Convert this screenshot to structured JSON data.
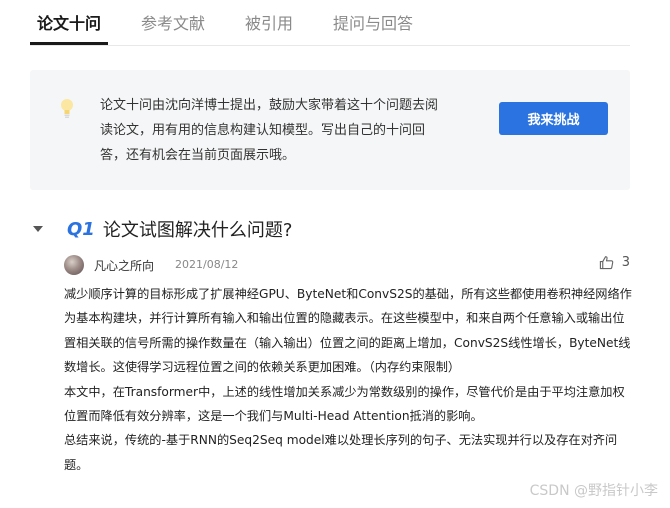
{
  "tabs": [
    {
      "label": "论文十问",
      "active": true
    },
    {
      "label": "参考文献",
      "active": false
    },
    {
      "label": "被引用",
      "active": false
    },
    {
      "label": "提问与回答",
      "active": false
    }
  ],
  "info": {
    "icon": "lightbulb-icon",
    "lines": [
      "论文十问由沈向洋博士提出，鼓励大家带着这十个问题去阅",
      "读论文，用有用的信息构建认知模型。写出自己的十问回",
      "答，还有机会在当前页面展示哦。"
    ],
    "button_label": "我来挑战",
    "button_color": "#2a73e0"
  },
  "question": {
    "number": "Q1",
    "title": "论文试图解决什么问题?"
  },
  "answer": {
    "author": "凡心之所向",
    "date": "2021/08/12",
    "likes": "3",
    "paragraphs": [
      "减少顺序计算的目标形成了扩展神经GPU、ByteNet和ConvS2S的基础，所有这些都使用卷积神经网络作为基本构建块，并行计算所有输入和输出位置的隐藏表示。在这些模型中，和来自两个任意输入或输出位置相关联的信号所需的操作数量在（输入输出）位置之间的距离上增加，ConvS2S线性增长，ByteNet线数增长。这使得学习远程位置之间的依赖关系更加困难。（内存约束限制）",
      "本文中，在Transformer中，上述的线性增加关系减少为常数级别的操作，尽管代价是由于平均注意加权位置而降低有效分辨率，这是一个我们与Multi-Head Attention抵消的影响。",
      "总结来说，传统的-基于RNN的Seq2Seq model难以处理长序列的句子、无法实现并行以及存在对齐问题。"
    ]
  },
  "watermark": "CSDN @野指针小李"
}
